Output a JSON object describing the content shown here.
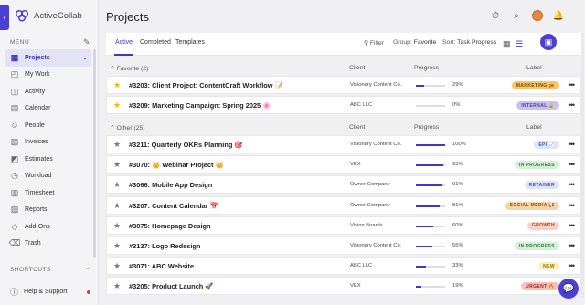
{
  "app": {
    "name": "ActiveCollab",
    "title": "Projects"
  },
  "sidebar": {
    "menu_label": "MENU",
    "items": [
      {
        "label": "Projects",
        "icon": "projects-icon",
        "active": true
      },
      {
        "label": "My Work",
        "icon": "my-work-icon"
      },
      {
        "label": "Activity",
        "icon": "activity-icon"
      },
      {
        "label": "Calendar",
        "icon": "calendar-icon"
      },
      {
        "label": "People",
        "icon": "people-icon"
      },
      {
        "label": "Invoices",
        "icon": "invoices-icon"
      },
      {
        "label": "Estimates",
        "icon": "estimates-icon"
      },
      {
        "label": "Workload",
        "icon": "workload-icon"
      },
      {
        "label": "Timesheet",
        "icon": "timesheet-icon"
      },
      {
        "label": "Reports",
        "icon": "reports-icon"
      },
      {
        "label": "Add-Ons",
        "icon": "add-ons-icon"
      },
      {
        "label": "Trash",
        "icon": "trash-icon"
      }
    ],
    "shortcuts_label": "SHORTCUTS",
    "help_label": "Help & Support"
  },
  "toolbar": {
    "tabs": [
      "Active",
      "Completed",
      "Templates"
    ],
    "filter_label": "Filter",
    "group_prefix": "Group:",
    "group_value": "Favorite",
    "sort_prefix": "Sort:",
    "sort_value": "Task Progress"
  },
  "columns": {
    "client": "Client",
    "progress": "Progress",
    "label": "Label"
  },
  "groups": [
    {
      "title": "Favorite (2)",
      "projects": [
        {
          "name": "#3203: Client Project: ContentCraft Workflow 📝",
          "client": "Visionary Content Co.",
          "progress": 0.29,
          "pct": "29%",
          "label": "MARKETING 📻",
          "label_bg": "#f6c66e",
          "label_fg": "#7a4b00",
          "favorite": true
        },
        {
          "name": "#3209: Marketing Campaign: Spring 2025 🌸",
          "client": "ABC LLC",
          "progress": 0.0,
          "pct": "0%",
          "label": "INTERNAL 🔒",
          "label_bg": "#c9c2ef",
          "label_fg": "#4a3da0",
          "favorite": true
        }
      ]
    },
    {
      "title": "Other (25)",
      "projects": [
        {
          "name": "#3211: Quarterly OKRs Planning 🎯",
          "client": "Visionary Content Co.",
          "progress": 1.0,
          "pct": "100%",
          "label": "EPI 📈",
          "label_bg": "#dbe6fb",
          "label_fg": "#3560b5",
          "favorite": false
        },
        {
          "name": "#3070: 👑 Webinar Project 👑",
          "client": "VEX",
          "progress": 0.93,
          "pct": "93%",
          "label": "IN PROGRESS",
          "label_bg": "#d3f1d9",
          "label_fg": "#2e7d3b",
          "favorite": false
        },
        {
          "name": "#3066: Mobile App Design",
          "client": "Owner Company",
          "progress": 0.91,
          "pct": "91%",
          "label": "RETAINER",
          "label_bg": "#dfe3f7",
          "label_fg": "#4a55a7",
          "favorite": false
        },
        {
          "name": "#3207: Content Calendar 📅",
          "client": "Owner Company",
          "progress": 0.81,
          "pct": "81%",
          "label": "SOCIAL MEDIA 📢",
          "label_bg": "#f7d4a7",
          "label_fg": "#8a4a00",
          "favorite": false
        },
        {
          "name": "#3075: Homepage Design",
          "client": "Vision Boards",
          "progress": 0.6,
          "pct": "60%",
          "label": "GROWTH",
          "label_bg": "#f4d3c6",
          "label_fg": "#9a4a2e",
          "favorite": false
        },
        {
          "name": "#3137: Logo Redesign",
          "client": "Visionary Content Co.",
          "progress": 0.55,
          "pct": "55%",
          "label": "IN PROGRESS",
          "label_bg": "#d3f1d9",
          "label_fg": "#2e7d3b",
          "favorite": false
        },
        {
          "name": "#3071: ABC Website",
          "client": "ABC LLC",
          "progress": 0.33,
          "pct": "33%",
          "label": "NEW",
          "label_bg": "#fbf0b8",
          "label_fg": "#8a7300",
          "favorite": false
        },
        {
          "name": "#3205: Product Launch 🚀",
          "client": "VEX",
          "progress": 0.19,
          "pct": "19%",
          "label": "URGENT 🔥",
          "label_bg": "#f6c1bd",
          "label_fg": "#a3241a",
          "favorite": false
        }
      ]
    }
  ]
}
